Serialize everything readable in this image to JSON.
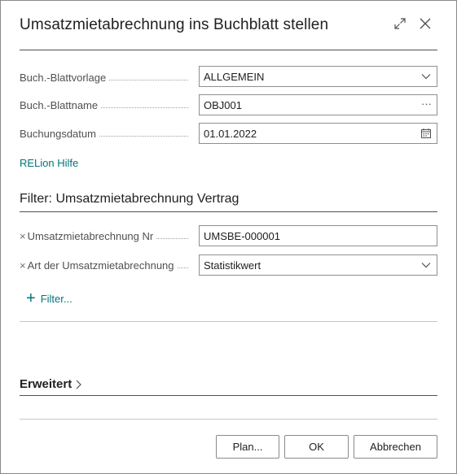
{
  "dialog": {
    "title": "Umsatzmietabrechnung ins Buchblatt stellen"
  },
  "fields": [
    {
      "label": "Buch.-Blattvorlage",
      "value": "ALLGEMEIN",
      "control": "dropdown",
      "icon": "chevron-down-icon"
    },
    {
      "label": "Buch.-Blattname",
      "value": "OBJ001",
      "control": "lookup",
      "icon": "ellipsis-icon",
      "trail": "···"
    },
    {
      "label": "Buchungsdatum",
      "value": "01.01.2022",
      "control": "date",
      "icon": "calendar-icon"
    }
  ],
  "help_link": "RELion Hilfe",
  "filter_section": {
    "title": "Filter: Umsatzmietabrechnung Vertrag",
    "filters": [
      {
        "label": "Umsatzmietabrechnung Nr",
        "value": "UMSBE-000001",
        "control": "text"
      },
      {
        "label": "Art der Umsatzmietabrechnung",
        "value": "Statistikwert",
        "control": "dropdown",
        "icon": "chevron-down-icon"
      }
    ],
    "add_filter_label": "Filter..."
  },
  "advanced": {
    "label": "Erweitert"
  },
  "buttons": {
    "plan": "Plan...",
    "ok": "OK",
    "cancel": "Abbrechen"
  },
  "colors": {
    "accent_link": "#00767a",
    "text": "#212121",
    "label": "#505050",
    "border": "#8f8f8f"
  }
}
